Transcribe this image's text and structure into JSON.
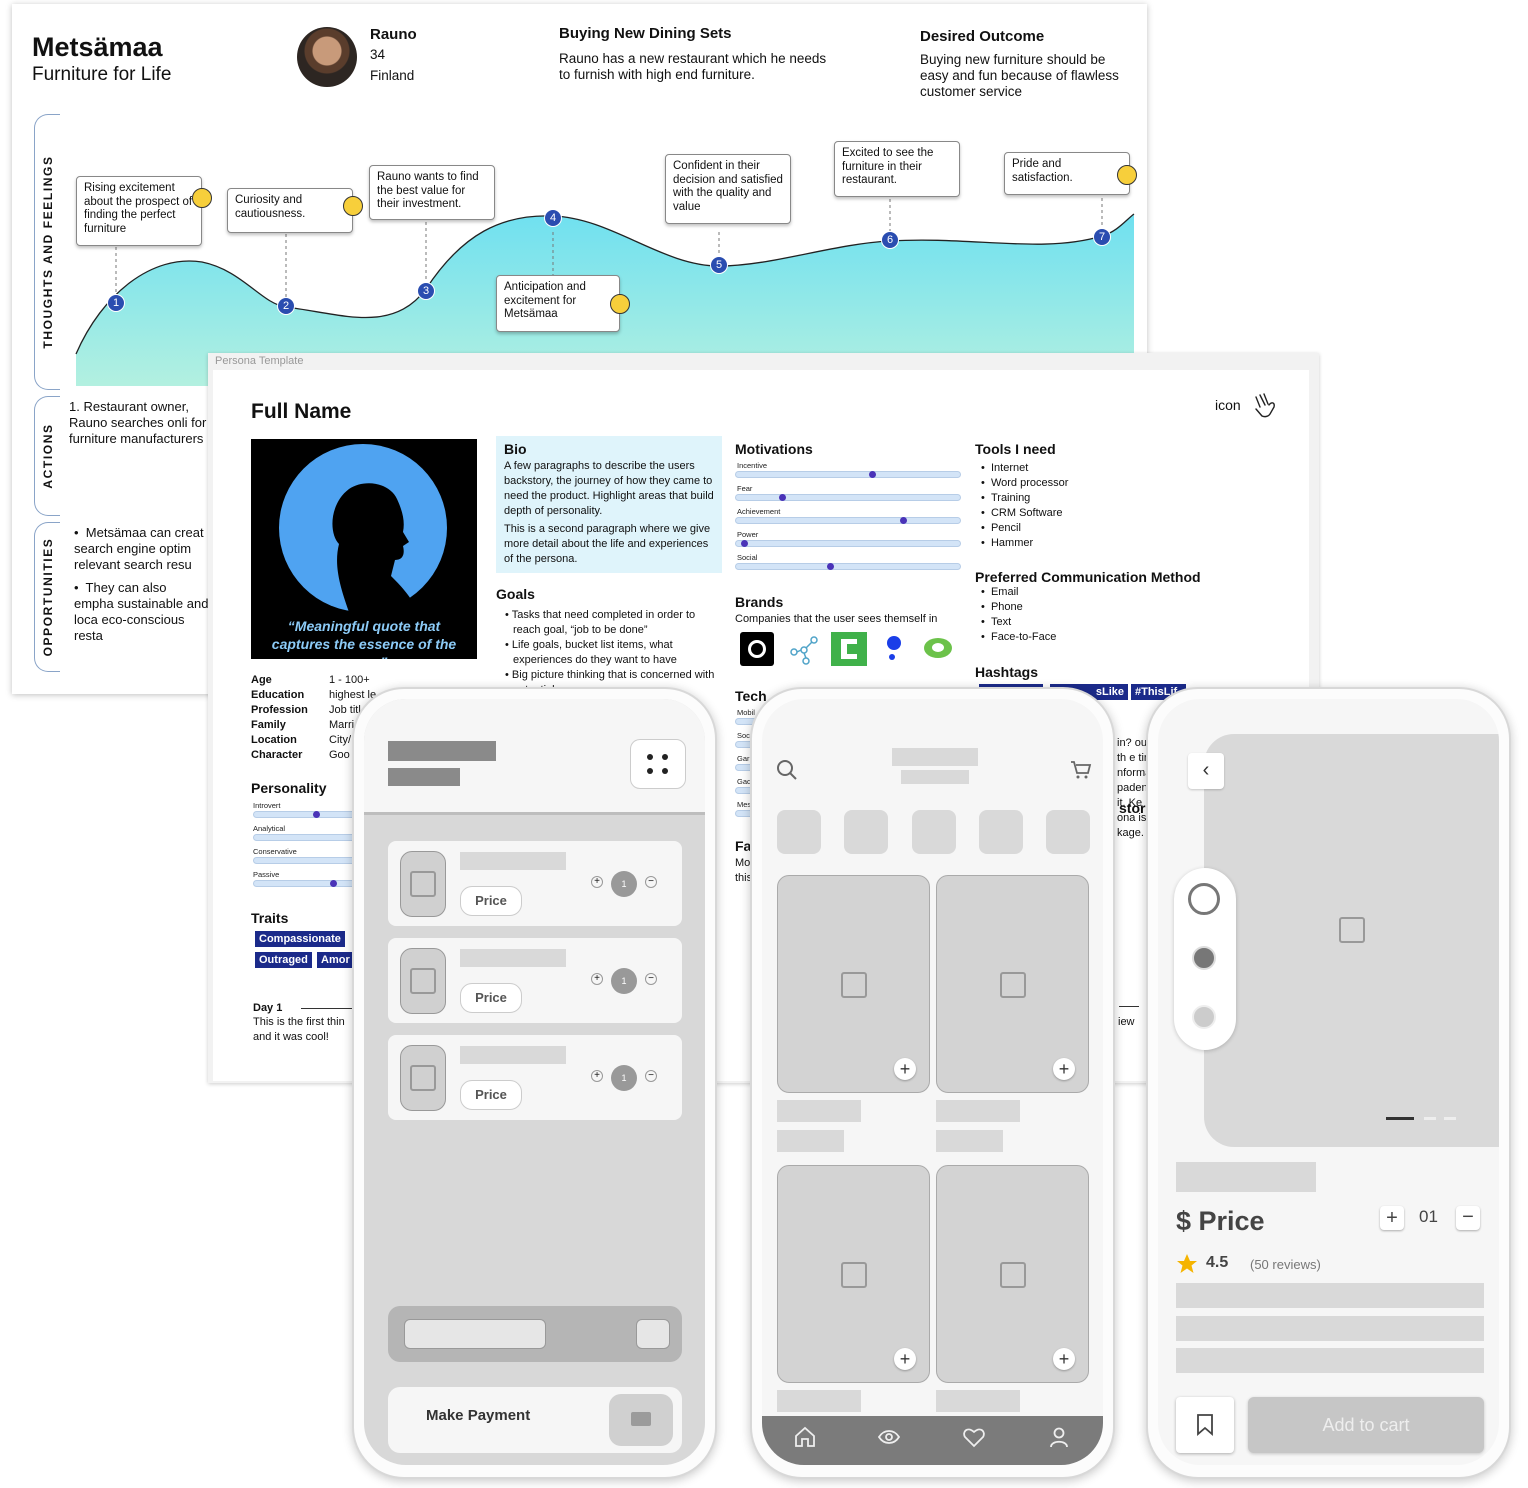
{
  "journey": {
    "brand": {
      "name": "Metsämaa",
      "tagline": "Furniture for Life"
    },
    "persona": {
      "name": "Rauno",
      "age": "34",
      "country": "Finland"
    },
    "scenario": {
      "title": "Buying New Dining Sets",
      "text": "Rauno has a new restaurant which he needs to furnish with high end furniture."
    },
    "outcome": {
      "title": "Desired Outcome",
      "text": "Buying new furniture should be easy and fun because of flawless customer service"
    },
    "lanes": {
      "thoughts": "THOUGHTS AND FEELINGS",
      "actions": "ACTIONS",
      "opportunities": "OPPORTUNITIES"
    },
    "steps": [
      {
        "n": "1",
        "text": "Rising excitement about the prospect of finding the perfect furniture"
      },
      {
        "n": "2",
        "text": "Curiosity and cautiousness."
      },
      {
        "n": "3",
        "text": "Rauno wants to find the best value for their investment."
      },
      {
        "n": "4",
        "text": "Anticipation and excitement for Metsämaa"
      },
      {
        "n": "5",
        "text": "Confident in their decision and satisfied with the quality and value"
      },
      {
        "n": "6",
        "text": "Excited to see the furniture in their restaurant."
      },
      {
        "n": "7",
        "text": "Pride and satisfaction."
      }
    ],
    "action_1": "1. Restaurant owner, Rauno searches onli for furniture manufacturers",
    "opp_1": "Metsämaa can creat search engine optim relevant search resu",
    "opp_2": "They can also empha sustainable and loca eco-conscious resta"
  },
  "persona_template": {
    "label": "Persona Template",
    "full_name": "Full Name",
    "icon_label": "icon",
    "quote": "“Meaningful quote that captures the essence of the group”",
    "details": [
      {
        "k": "Age",
        "v": "1 - 100+"
      },
      {
        "k": "Education",
        "v": "highest le"
      },
      {
        "k": "Profession",
        "v": "Job titl"
      },
      {
        "k": "Family",
        "v": "Marri"
      },
      {
        "k": "Location",
        "v": "City/"
      },
      {
        "k": "Character",
        "v": "Goo"
      }
    ],
    "bio_title": "Bio",
    "bio_p1": "A few paragraphs to describe the users backstory, the journey of how they came to need the product. Highlight areas that build depth of personality.",
    "bio_p2": "This is a second paragraph where we give more detail about the life and experiences of the persona.",
    "goals_title": "Goals",
    "goals": [
      "Tasks that need completed in order to reach goal, “job to be done”",
      "Life goals, bucket list items, what experiences do they want to have",
      "Big picture thinking that is concerned with potential successes"
    ],
    "motivations_title": "Motivations",
    "motivations": [
      {
        "label": "Incentive",
        "value": 0.6
      },
      {
        "label": "Fear",
        "value": 0.2
      },
      {
        "label": "Achievement",
        "value": 0.75
      },
      {
        "label": "Power",
        "value": 0.04
      },
      {
        "label": "Social",
        "value": 0.42
      }
    ],
    "brands_title": "Brands",
    "brands_sub": "Companies that the user sees themself in",
    "tools_title": "Tools I need",
    "tools": [
      "Internet",
      "Word processor",
      "Training",
      "CRM Software",
      "Pencil",
      "Hammer"
    ],
    "comm_title": "Preferred Communication Method",
    "comm": [
      "Email",
      "Phone",
      "Text",
      "Face-to-Face"
    ],
    "hashtags_title": "Hashtags",
    "hashtags": [
      "#ThisLif",
      "sLike",
      ""
    ],
    "personality_title": "Personality",
    "personality": [
      {
        "label": "Introvert",
        "value": 0.65
      },
      {
        "label": "Analytical",
        "value": 0.5
      },
      {
        "label": "Conservative",
        "value": 0.5
      },
      {
        "label": "Passive",
        "value": 0.8
      }
    ],
    "traits_title": "Traits",
    "traits": [
      "Compassionate",
      "Outraged",
      "Amor"
    ],
    "tech_title": "Tech",
    "tech": [
      "Mobil",
      "Soc",
      "Gar",
      "Gad",
      "Mes"
    ],
    "fav_title": "Fa",
    "fav_text": "Mo this",
    "story_title": "stor",
    "story_text": "in? out th e time nforma paden g it. Ke ona is kage.",
    "day_title": "Day 1",
    "day_text": "This is the first thin and it was cool!",
    "right_snippet": "iew"
  },
  "phone_cart": {
    "items": [
      {
        "price_label": "Price",
        "qty": "1"
      },
      {
        "price_label": "Price",
        "qty": "1"
      },
      {
        "price_label": "Price",
        "qty": "1"
      }
    ],
    "pay_label": "Make Payment"
  },
  "phone_shop": {
    "categories": 5,
    "tabs": [
      "home-icon",
      "eye-icon",
      "heart-icon",
      "user-icon"
    ]
  },
  "phone_product": {
    "price": "$ Price",
    "qty": "01",
    "rating": "4.5",
    "reviews": "(50 reviews)",
    "add_to_cart": "Add to cart"
  }
}
